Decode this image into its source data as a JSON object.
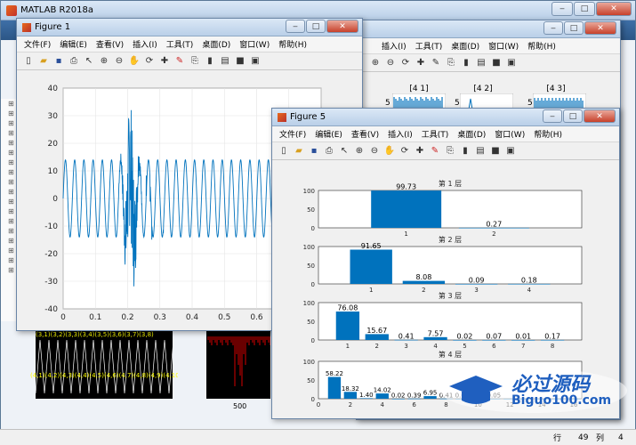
{
  "main_window": {
    "title": "MATLAB R2018a"
  },
  "figure1": {
    "title": "Figure 1",
    "menu": [
      "文件(F)",
      "编辑(E)",
      "查看(V)",
      "插入(I)",
      "工具(T)",
      "桌面(D)",
      "窗口(W)",
      "帮助(H)"
    ]
  },
  "figure5": {
    "title": "Figure 5",
    "menu": [
      "文件(F)",
      "编辑(E)",
      "查看(V)",
      "插入(I)",
      "工具(T)",
      "桌面(D)",
      "窗口(W)",
      "帮助(H)"
    ]
  },
  "background_window": {
    "menu": [
      "插入(I)",
      "工具(T)",
      "桌面(D)",
      "窗口(W)",
      "帮助(H)"
    ],
    "subplot_titles": [
      "[4 1]",
      "[4 2]",
      "[4 3]"
    ],
    "axis_label_5": "5",
    "tick_500": "500",
    "overlay_text_top": "(3,1)(3,2)(3,3)(3,4)(3,5)(3,6)(3,7)(3,8)",
    "overlay_text_bottom": "(4,1)(4,2)(4,3)(4,4)(4,5)(4,6)(4,7)(4,8)(4,9)(4,10)(4,11)(4,12)(4,13)(4,14)(4,15)"
  },
  "statusbar": {
    "row_label": "行",
    "row_value": "49",
    "col_label": "列",
    "col_value": "4"
  },
  "watermark": {
    "brand": "必过源码",
    "site": "Biguo100.com"
  },
  "chart_data": [
    {
      "type": "line",
      "title": "",
      "xlabel": "",
      "ylabel": "",
      "xlim": [
        0,
        0.8
      ],
      "ylim": [
        -40,
        40
      ],
      "xticks": [
        "0",
        "0.1",
        "0.2",
        "0.3",
        "0.4",
        "0.5",
        "0.6",
        "0.7",
        "0.8"
      ],
      "yticks": [
        "40",
        "30",
        "20",
        "10",
        "0",
        "-10",
        "-20",
        "-30",
        "-40"
      ],
      "grid": true,
      "series_color": "#0072BD",
      "description_note_values": {
        "base_amplitude": 14,
        "period": 0.0286,
        "burst_center": 0.21,
        "burst_peak": 30
      }
    },
    {
      "type": "bar",
      "title": "第 1 层",
      "categories": [
        "1",
        "2"
      ],
      "values": [
        99.73,
        0.27
      ],
      "value_labels": [
        "99.73",
        "0.27"
      ],
      "ylim": [
        0,
        100
      ],
      "yticks": [
        "100",
        "50",
        "0"
      ],
      "xticks": [
        "1",
        "2"
      ],
      "bar_color": "#0072BD"
    },
    {
      "type": "bar",
      "title": "第 2 层",
      "categories": [
        "1",
        "2",
        "3",
        "4"
      ],
      "values": [
        91.65,
        8.08,
        0.09,
        0.18
      ],
      "value_labels": [
        "91.65",
        "8.08",
        "0.09",
        "0.18"
      ],
      "ylim": [
        0,
        100
      ],
      "yticks": [
        "100",
        "50",
        "0"
      ],
      "xticks": [
        "1",
        "2",
        "3",
        "4"
      ],
      "bar_color": "#0072BD"
    },
    {
      "type": "bar",
      "title": "第 3 层",
      "categories": [
        "1",
        "2",
        "3",
        "4",
        "5",
        "6",
        "7",
        "8"
      ],
      "values": [
        76.08,
        15.67,
        0.41,
        7.57,
        0.02,
        0.07,
        0.01,
        0.17
      ],
      "value_labels": [
        "76.08",
        "15.67",
        "0.41",
        "7.57",
        "0.02",
        "0.07",
        "0.01",
        "0.17"
      ],
      "ylim": [
        0,
        100
      ],
      "yticks": [
        "100",
        "50",
        "0"
      ],
      "xticks": [
        "1",
        "2",
        "3",
        "4",
        "5",
        "6",
        "7",
        "8"
      ],
      "bar_color": "#0072BD"
    },
    {
      "type": "bar",
      "title": "第 4 层",
      "categories": [
        "1",
        "2",
        "3",
        "4",
        "5",
        "6",
        "7",
        "8",
        "9",
        "10",
        "11",
        "12",
        "13",
        "14",
        "15",
        "16"
      ],
      "values": [
        58.22,
        18.32,
        1.4,
        14.02,
        0.02,
        0.39,
        6.95,
        0.41,
        0.01,
        0.02,
        0.05,
        0.02,
        0.01,
        0.01,
        0.01,
        0.16
      ],
      "value_labels": [
        "58.22",
        "18.32",
        "1.40",
        "14.02",
        "0.02",
        "0.39",
        "6.95",
        "0.41",
        "0.01",
        "0.02",
        "0.05",
        "",
        "",
        "",
        "",
        ""
      ],
      "ylim": [
        0,
        100
      ],
      "yticks": [
        "100",
        "50",
        "0"
      ],
      "xticks": [
        "0",
        "2",
        "4",
        "6",
        "8",
        "10",
        "12",
        "14",
        "16"
      ],
      "bar_color": "#0072BD"
    }
  ]
}
